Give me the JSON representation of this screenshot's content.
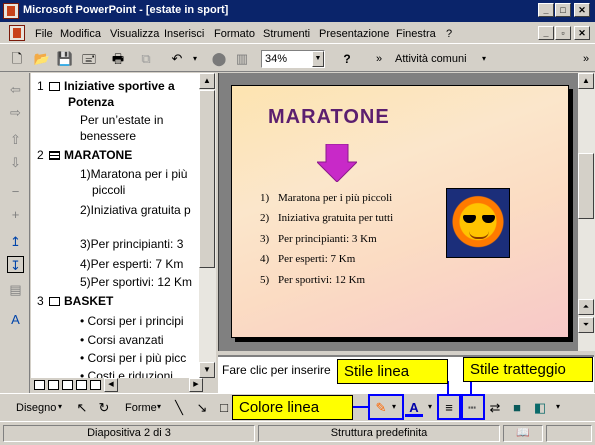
{
  "window": {
    "title": "Microsoft PowerPoint - [estate in sport]"
  },
  "menu": [
    "File",
    "Modifica",
    "Visualizza",
    "Inserisci",
    "Formato",
    "Strumenti",
    "Presentazione",
    "Finestra",
    "?"
  ],
  "toolbar": {
    "zoom": "34%",
    "activity": "Attività comuni"
  },
  "outline": {
    "slides": [
      {
        "num": "1",
        "title_line1": "Iniziative sportive a",
        "title_line2": "Potenza",
        "body": [
          "Per un’estate in",
          "benessere"
        ]
      },
      {
        "num": "2",
        "title": "MARATONE",
        "items": [
          "1)Maratona per i più",
          "piccoli",
          "2)Iniziativa gratuita p",
          "3)Per principianti: 3",
          "4)Per esperti: 7 Km",
          "5)Per sportivi: 12 Km"
        ]
      },
      {
        "num": "3",
        "title": "BASKET",
        "items": [
          "Corsi per i principi",
          "Corsi avanzati",
          "Corsi per i più picc",
          "Costi e riduzioni"
        ]
      }
    ]
  },
  "slide": {
    "title": "MARATONE",
    "items": [
      {
        "num": "1)",
        "text": "Maratona per i più piccoli"
      },
      {
        "num": "2)",
        "text": "Iniziativa gratuita per tutti"
      },
      {
        "num": "3)",
        "text": "Per principianti: 3 Km"
      },
      {
        "num": "4)",
        "text": "Per esperti: 7 Km"
      },
      {
        "num": "5)",
        "text": "Per sportivi: 12 Km"
      }
    ]
  },
  "notes": {
    "text": "Fare clic per inserire"
  },
  "drawing": {
    "draw_label": "Disegno",
    "shapes_label": "Forme"
  },
  "callouts": {
    "line_style": "Stile linea",
    "dash_style": "Stile tratteggio",
    "line_color": "Colore linea"
  },
  "status": {
    "slide": "Diapositiva 2 di 3",
    "design": "Struttura predefinita"
  }
}
